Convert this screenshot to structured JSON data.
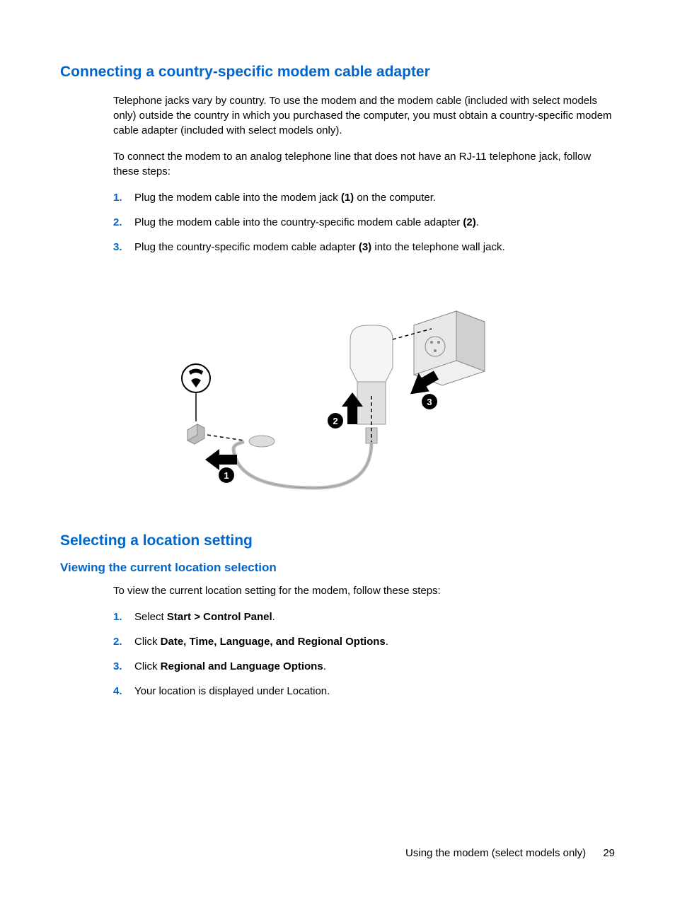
{
  "heading1": "Connecting a country-specific modem cable adapter",
  "para1": "Telephone jacks vary by country. To use the modem and the modem cable (included with select models only) outside the country in which you purchased the computer, you must obtain a country-specific modem cable adapter (included with select models only).",
  "para2": "To connect the modem to an analog telephone line that does not have an RJ-11 telephone jack, follow these steps:",
  "steps1": [
    {
      "num": "1.",
      "pre": "Plug the modem cable into the modem jack ",
      "bold": "(1)",
      "post": " on the computer."
    },
    {
      "num": "2.",
      "pre": "Plug the modem cable into the country-specific modem cable adapter ",
      "bold": "(2)",
      "post": "."
    },
    {
      "num": "3.",
      "pre": "Plug the country-specific modem cable adapter ",
      "bold": "(3)",
      "post": " into the telephone wall jack."
    }
  ],
  "heading2": "Selecting a location setting",
  "heading3": "Viewing the current location selection",
  "para3": "To view the current location setting for the modem, follow these steps:",
  "steps2": [
    {
      "num": "1.",
      "pre": "Select ",
      "bold": "Start > Control Panel",
      "post": "."
    },
    {
      "num": "2.",
      "pre": "Click ",
      "bold": "Date, Time, Language, and Regional Options",
      "post": "."
    },
    {
      "num": "3.",
      "pre": "Click ",
      "bold": "Regional and Language Options",
      "post": "."
    },
    {
      "num": "4.",
      "pre": "Your location is displayed under Location.",
      "bold": "",
      "post": ""
    }
  ],
  "footer_text": "Using the modem (select models only)",
  "page_number": "29"
}
